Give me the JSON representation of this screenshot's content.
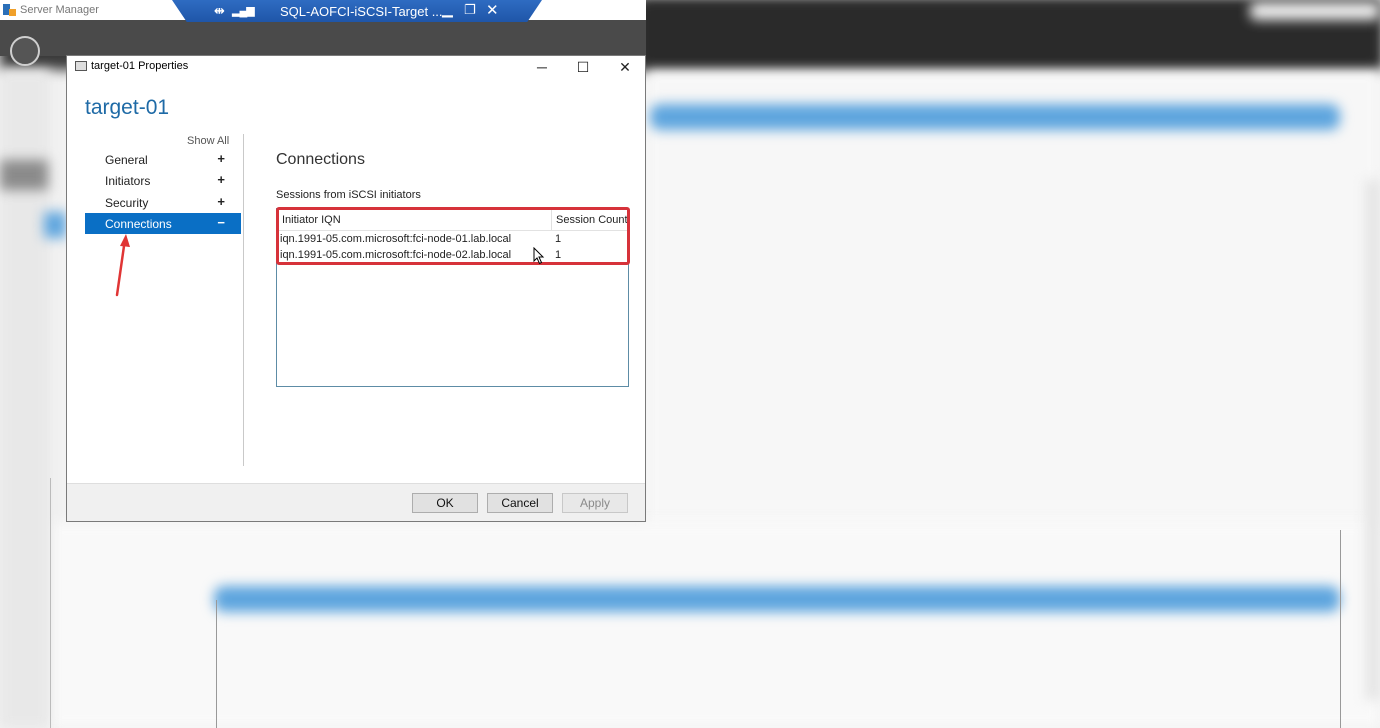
{
  "server_manager": {
    "title": "Server Manager"
  },
  "rdp_bar": {
    "title": "SQL-AOFCI-iSCSI-Target ...",
    "pin_icon": "pin-icon",
    "signal_icon": "signal-icon"
  },
  "dialog": {
    "window_title": "target-01 Properties",
    "header": "target-01",
    "show_all": "Show All",
    "nav": [
      {
        "label": "General",
        "sign": "+"
      },
      {
        "label": "Initiators",
        "sign": "+"
      },
      {
        "label": "Security",
        "sign": "+"
      },
      {
        "label": "Connections",
        "sign": "−",
        "active": true
      }
    ],
    "section_title": "Connections",
    "sessions_label": "Sessions from iSCSI initiators",
    "table": {
      "columns": [
        "Initiator IQN",
        "Session Count"
      ],
      "rows": [
        {
          "iqn": "iqn.1991-05.com.microsoft:fci-node-01.lab.local",
          "count": "1"
        },
        {
          "iqn": "iqn.1991-05.com.microsoft:fci-node-02.lab.local",
          "count": "1"
        }
      ]
    },
    "buttons": {
      "ok": "OK",
      "cancel": "Cancel",
      "apply": "Apply"
    }
  },
  "colors": {
    "accent": "#0a6fc5",
    "header_text": "#1e6aa6",
    "highlight": "#d6323a",
    "rdp_bar": "#2e6cc2"
  }
}
